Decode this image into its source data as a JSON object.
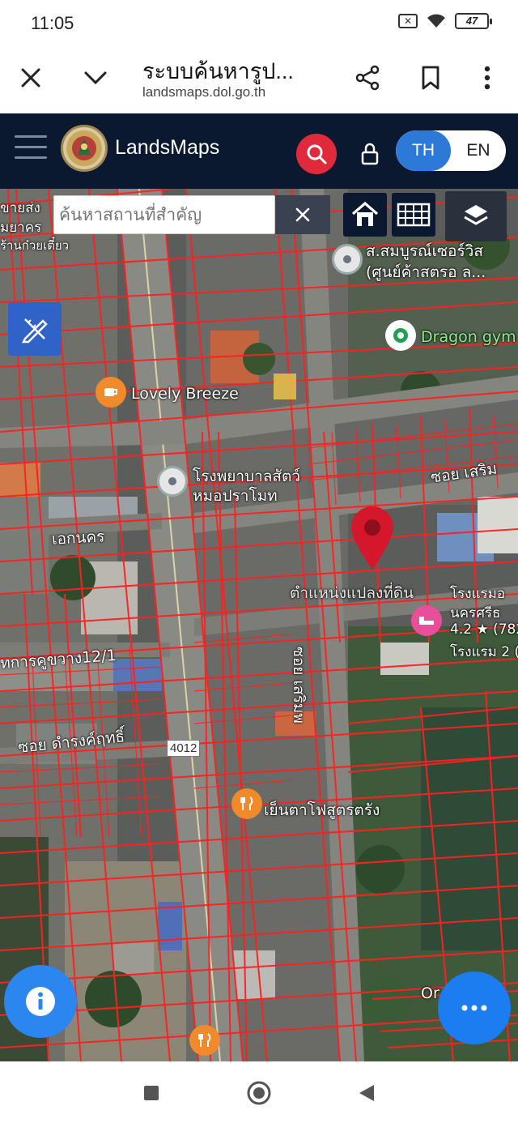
{
  "status": {
    "time": "11:05",
    "battery": "47"
  },
  "browser": {
    "title": "ระบบค้นหารูป...",
    "url": "landsmaps.dol.go.th"
  },
  "header": {
    "brand": "LandsMaps",
    "lang_th": "TH",
    "lang_en": "EN"
  },
  "map": {
    "search_placeholder": "ค้นหาสถานที่สำคัญ",
    "road_number": "4012",
    "labels": {
      "lovely_breeze": "Lovely Breeze",
      "dragon_gym": "Dragon gym",
      "shop_top": "ส.สมบูรณ์เซอร์วิส",
      "shop_top2": "(ศูนย์ค้าสตรอ ล...",
      "vet_hospital_1": "โรงพยาบาลสัตว์",
      "vet_hospital_2": "หมอปราโมท",
      "soi_serm": "ซอย เสริม",
      "ekanakorn": "เอกนคร",
      "parcel_position": "ตำแหน่งแปลงที่ดิน",
      "hotel_1": "โรงแรมอ",
      "hotel_2": "นครศรีธ",
      "hotel_3": "4.2 ★ (782",
      "hotel_4": "โรงแรม 2 (",
      "karukwang": "ทการคูขวาง12/1",
      "soi_dumrong": "ซอย ดำรงค์ฤทธิ์",
      "soi_serm_v": "ซอย เสริมพ",
      "restaurant": "เย็นตาโฟสูตรตรัง",
      "top_left_1": "ขายส่ง",
      "top_left_2": "มยาคร",
      "top_left_3": "ร้านก๋วยเตี๋ยว",
      "bottom_right": "Or"
    }
  }
}
